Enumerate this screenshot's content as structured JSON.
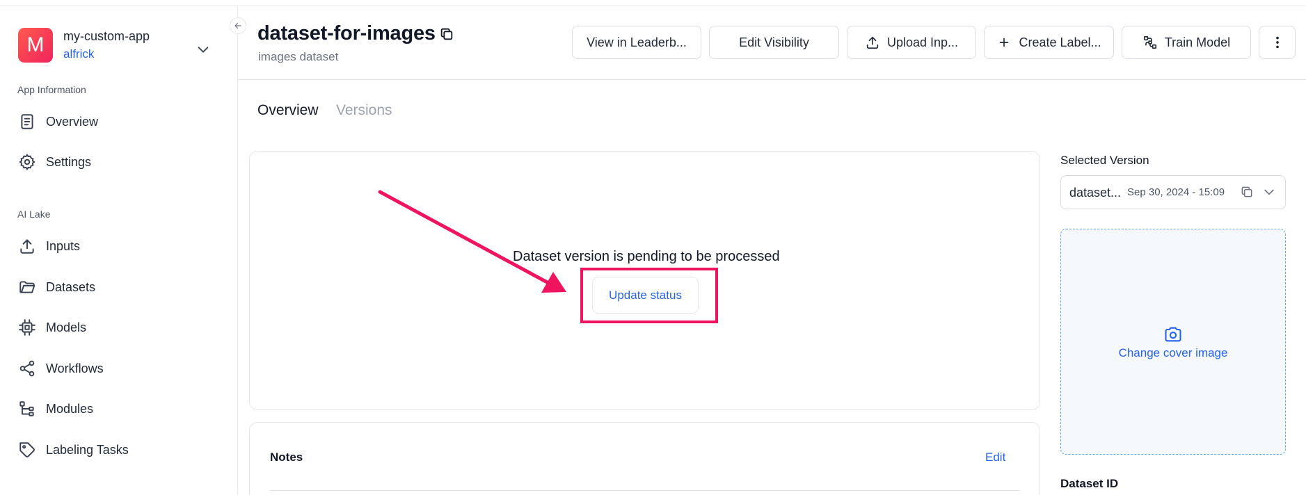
{
  "app": {
    "avatar_letter": "M",
    "name": "my-custom-app",
    "user": "alfrick"
  },
  "sidebar": {
    "section_app_info": "App Information",
    "section_ai_lake": "AI Lake",
    "items": [
      {
        "label": "Overview",
        "icon": "document-icon"
      },
      {
        "label": "Settings",
        "icon": "gear-icon"
      },
      {
        "label": "Inputs",
        "icon": "upload-icon"
      },
      {
        "label": "Datasets",
        "icon": "folder-icon"
      },
      {
        "label": "Models",
        "icon": "chip-icon"
      },
      {
        "label": "Workflows",
        "icon": "share-icon"
      },
      {
        "label": "Modules",
        "icon": "tree-icon"
      },
      {
        "label": "Labeling Tasks",
        "icon": "tag-icon"
      }
    ]
  },
  "header": {
    "title": "dataset-for-images",
    "subtitle": "images dataset",
    "buttons": {
      "leaderboard": "View in Leaderb...",
      "visibility": "Edit Visibility",
      "upload": "Upload Inp...",
      "create_label": "Create Label...",
      "train_model": "Train Model"
    }
  },
  "tabs": {
    "overview": "Overview",
    "versions": "Versions"
  },
  "main": {
    "pending_message": "Dataset version is pending to be processed",
    "update_button": "Update status"
  },
  "notes": {
    "title": "Notes",
    "edit": "Edit"
  },
  "right": {
    "selected_version_label": "Selected Version",
    "version_name": "dataset...",
    "version_date": "Sep 30, 2024 - 15:09",
    "change_cover": "Change cover image",
    "dataset_id_label": "Dataset ID"
  },
  "colors": {
    "accent_blue": "#2563eb",
    "highlight_pink": "#f0145e",
    "avatar_gradient_start": "#ff5a4e",
    "avatar_gradient_end": "#f0245d"
  }
}
